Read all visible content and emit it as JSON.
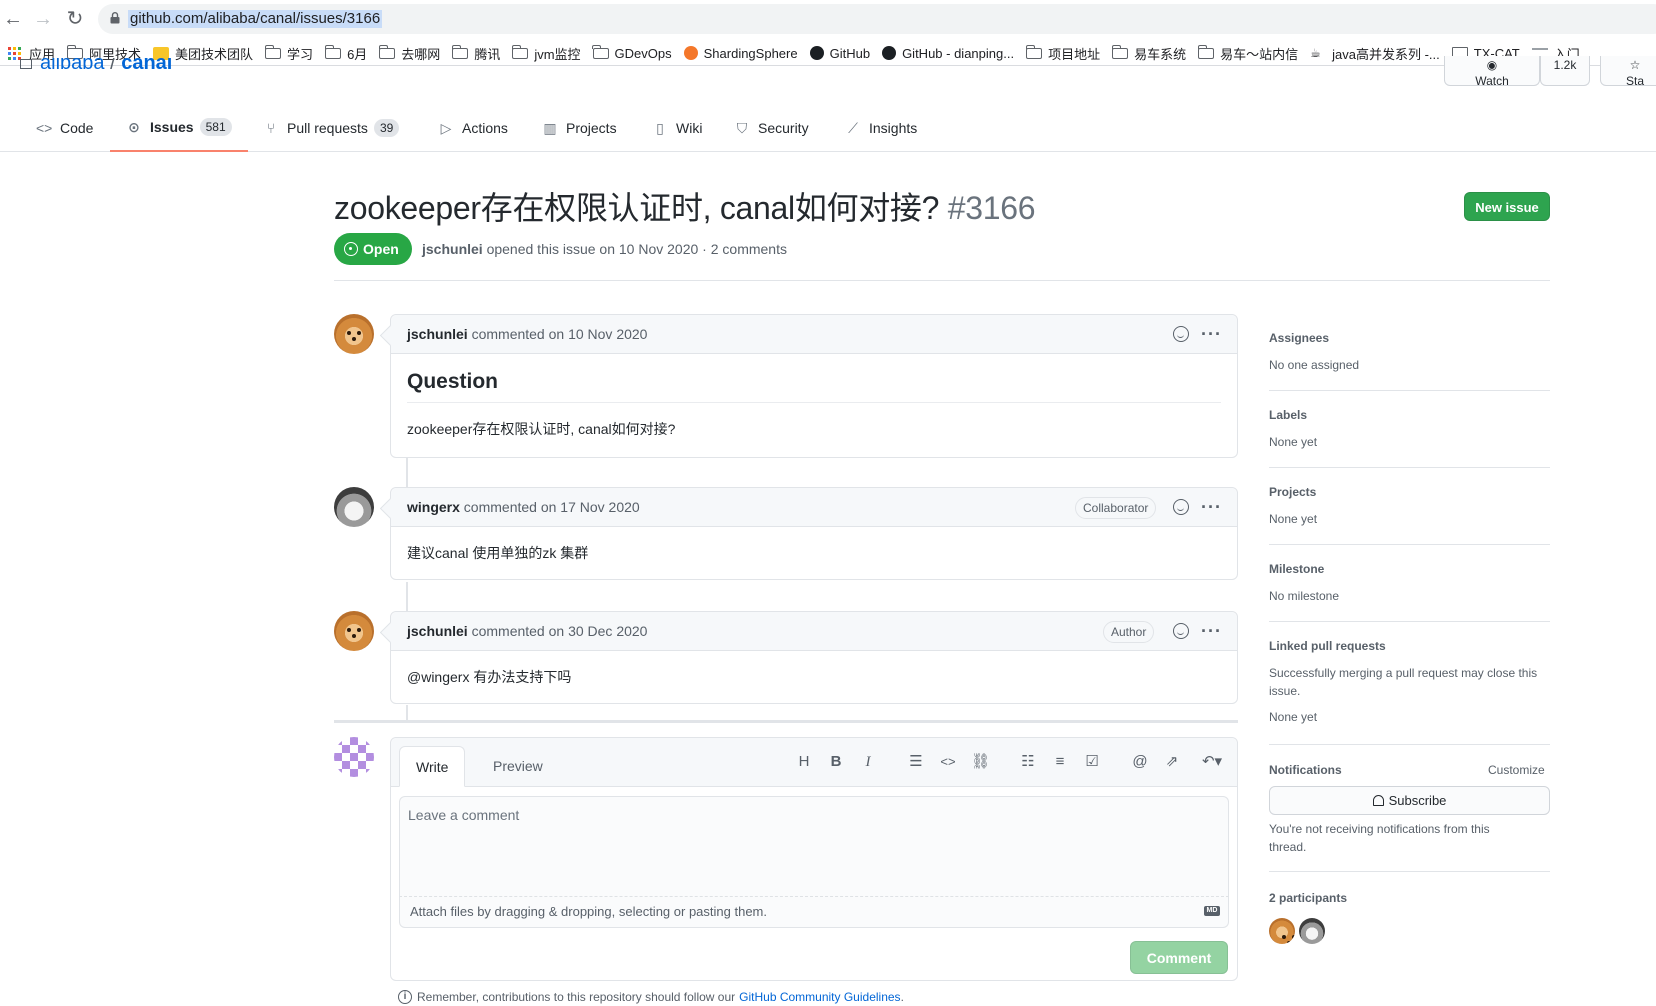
{
  "browser": {
    "url": "github.com/alibaba/canal/issues/3166",
    "bookmarks": [
      {
        "label": "应用",
        "icon": "apps-grid-icon"
      },
      {
        "label": "阿里技术",
        "icon": "folder-icon"
      },
      {
        "label": "美团技术团队",
        "icon": "meituan-icon"
      },
      {
        "label": "学习",
        "icon": "folder-icon"
      },
      {
        "label": "6月",
        "icon": "folder-icon"
      },
      {
        "label": "去哪网",
        "icon": "folder-icon"
      },
      {
        "label": "腾讯",
        "icon": "folder-icon"
      },
      {
        "label": "jvm监控",
        "icon": "folder-icon"
      },
      {
        "label": "GDevOps",
        "icon": "folder-icon"
      },
      {
        "label": "ShardingSphere",
        "icon": "shardingsphere-icon"
      },
      {
        "label": "GitHub",
        "icon": "github-icon"
      },
      {
        "label": "GitHub - dianping...",
        "icon": "github-icon"
      },
      {
        "label": "项目地址",
        "icon": "folder-icon"
      },
      {
        "label": "易车系统",
        "icon": "folder-icon"
      },
      {
        "label": "易车～站内信",
        "icon": "folder-icon"
      },
      {
        "label": "java高并发系列 -...",
        "icon": "java-icon"
      },
      {
        "label": "TX-CAT",
        "icon": "image-icon"
      },
      {
        "label": "入门",
        "icon": "doc-icon"
      }
    ]
  },
  "repo": {
    "owner": "alibaba",
    "name": "canal",
    "watch_label": "Watch",
    "watch_count": "1.2k",
    "star_label": "Sta"
  },
  "tabs": [
    {
      "label": "Code",
      "icon": "code-icon"
    },
    {
      "label": "Issues",
      "count": "581",
      "icon": "issue-opened-icon"
    },
    {
      "label": "Pull requests",
      "count": "39",
      "icon": "pull-request-icon"
    },
    {
      "label": "Actions",
      "icon": "play-icon"
    },
    {
      "label": "Projects",
      "icon": "project-icon"
    },
    {
      "label": "Wiki",
      "icon": "book-icon"
    },
    {
      "label": "Security",
      "icon": "shield-icon"
    },
    {
      "label": "Insights",
      "icon": "graph-icon"
    }
  ],
  "issue": {
    "title": "zookeeper存在权限认证时, canal如何对接? ",
    "number": "#3166",
    "new_issue_label": "New issue",
    "state": "Open",
    "author": "jschunlei",
    "meta": " opened this issue on 10 Nov 2020 · 2 comments"
  },
  "comments": [
    {
      "author": "jschunlei",
      "when": " commented on 10 Nov 2020",
      "heading": "Question",
      "body": "zookeeper存在权限认证时, canal如何对接?"
    },
    {
      "author": "wingerx",
      "when": " commented on 17 Nov 2020",
      "badge": "Collaborator",
      "body": "建议canal 使用单独的zk 集群"
    },
    {
      "author": "jschunlei",
      "when": " commented on 30 Dec 2020",
      "badge": "Author",
      "body": "@wingerx 有办法支持下吗"
    }
  ],
  "editor": {
    "write_label": "Write",
    "preview_label": "Preview",
    "placeholder": "Leave a comment",
    "attach_text": "Attach files by dragging & dropping, selecting or pasting them.",
    "md_label": "MD",
    "comment_label": "Comment",
    "remember_text": "Remember, contributions to this repository should follow our",
    "guidelines_link": "GitHub Community Guidelines",
    "remember_tail": "."
  },
  "sidebar": {
    "assignees_label": "Assignees",
    "assignees_value": "No one assigned",
    "labels_label": "Labels",
    "labels_value": "None yet",
    "projects_label": "Projects",
    "projects_value": "None yet",
    "milestone_label": "Milestone",
    "milestone_value": "No milestone",
    "linked_label": "Linked pull requests",
    "linked_desc": "Successfully merging a pull request may close this issue.",
    "linked_value": "None yet",
    "notifications_label": "Notifications",
    "customize_label": "Customize",
    "subscribe_label": "Subscribe",
    "notif_desc": "You're not receiving notifications from this thread.",
    "participants_label": "2 participants"
  },
  "colors": {
    "accent_green": "#2ea44f",
    "open_green": "#28a745",
    "link_blue": "#0366d6",
    "tab_underline": "#f9826c"
  }
}
